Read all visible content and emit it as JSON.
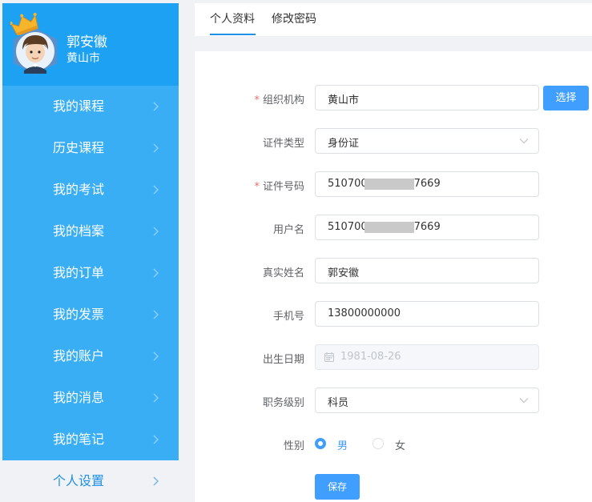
{
  "user": {
    "name": "郭安徽",
    "city": "黄山市"
  },
  "nav": [
    {
      "label": "我的课程"
    },
    {
      "label": "历史课程"
    },
    {
      "label": "我的考试"
    },
    {
      "label": "我的档案"
    },
    {
      "label": "我的订单"
    },
    {
      "label": "我的发票"
    },
    {
      "label": "我的账户"
    },
    {
      "label": "我的消息"
    },
    {
      "label": "我的笔记"
    },
    {
      "label": "个人设置",
      "active": true
    }
  ],
  "tabs": [
    {
      "label": "个人资料",
      "active": true
    },
    {
      "label": "修改密码"
    }
  ],
  "form": {
    "org": {
      "label": "组织机构",
      "value": "黄山市",
      "required": true
    },
    "select_button": "选择",
    "id_type": {
      "label": "证件类型",
      "value": "身份证"
    },
    "id_number": {
      "label": "证件号码",
      "value": "510700",
      "value_tail": "7669",
      "required": true
    },
    "username": {
      "label": "用户名",
      "value": "510700",
      "value_tail": "7669"
    },
    "real_name": {
      "label": "真实姓名",
      "value": "郭安徽"
    },
    "phone": {
      "label": "手机号",
      "value": "13800000000"
    },
    "birthdate": {
      "label": "出生日期",
      "value": "1981-08-26"
    },
    "job_level": {
      "label": "职务级别",
      "value": "科员"
    },
    "gender": {
      "label": "性别",
      "options": [
        "男",
        "女"
      ],
      "selected": "男"
    },
    "required_mark": "*",
    "save_button": "保存"
  },
  "colors": {
    "primary": "#409eff",
    "sidebar": "#3aaef4",
    "profile_bg": "#1da1f2",
    "required": "#f56c6c"
  },
  "icons": {
    "chevron": "chevron-right-icon",
    "dropdown": "chevron-down-icon",
    "calendar": "calendar-icon",
    "crown": "crown-icon"
  }
}
